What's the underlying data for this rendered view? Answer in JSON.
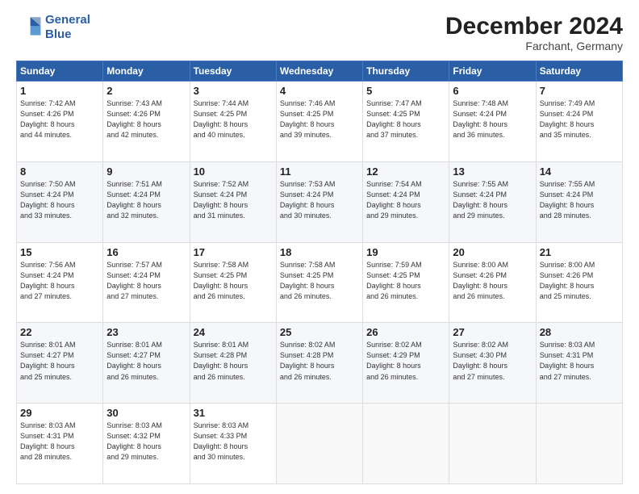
{
  "logo": {
    "line1": "General",
    "line2": "Blue"
  },
  "title": "December 2024",
  "subtitle": "Farchant, Germany",
  "days_of_week": [
    "Sunday",
    "Monday",
    "Tuesday",
    "Wednesday",
    "Thursday",
    "Friday",
    "Saturday"
  ],
  "weeks": [
    [
      {
        "day": "1",
        "detail": "Sunrise: 7:42 AM\nSunset: 4:26 PM\nDaylight: 8 hours\nand 44 minutes."
      },
      {
        "day": "2",
        "detail": "Sunrise: 7:43 AM\nSunset: 4:26 PM\nDaylight: 8 hours\nand 42 minutes."
      },
      {
        "day": "3",
        "detail": "Sunrise: 7:44 AM\nSunset: 4:25 PM\nDaylight: 8 hours\nand 40 minutes."
      },
      {
        "day": "4",
        "detail": "Sunrise: 7:46 AM\nSunset: 4:25 PM\nDaylight: 8 hours\nand 39 minutes."
      },
      {
        "day": "5",
        "detail": "Sunrise: 7:47 AM\nSunset: 4:25 PM\nDaylight: 8 hours\nand 37 minutes."
      },
      {
        "day": "6",
        "detail": "Sunrise: 7:48 AM\nSunset: 4:24 PM\nDaylight: 8 hours\nand 36 minutes."
      },
      {
        "day": "7",
        "detail": "Sunrise: 7:49 AM\nSunset: 4:24 PM\nDaylight: 8 hours\nand 35 minutes."
      }
    ],
    [
      {
        "day": "8",
        "detail": "Sunrise: 7:50 AM\nSunset: 4:24 PM\nDaylight: 8 hours\nand 33 minutes."
      },
      {
        "day": "9",
        "detail": "Sunrise: 7:51 AM\nSunset: 4:24 PM\nDaylight: 8 hours\nand 32 minutes."
      },
      {
        "day": "10",
        "detail": "Sunrise: 7:52 AM\nSunset: 4:24 PM\nDaylight: 8 hours\nand 31 minutes."
      },
      {
        "day": "11",
        "detail": "Sunrise: 7:53 AM\nSunset: 4:24 PM\nDaylight: 8 hours\nand 30 minutes."
      },
      {
        "day": "12",
        "detail": "Sunrise: 7:54 AM\nSunset: 4:24 PM\nDaylight: 8 hours\nand 29 minutes."
      },
      {
        "day": "13",
        "detail": "Sunrise: 7:55 AM\nSunset: 4:24 PM\nDaylight: 8 hours\nand 29 minutes."
      },
      {
        "day": "14",
        "detail": "Sunrise: 7:55 AM\nSunset: 4:24 PM\nDaylight: 8 hours\nand 28 minutes."
      }
    ],
    [
      {
        "day": "15",
        "detail": "Sunrise: 7:56 AM\nSunset: 4:24 PM\nDaylight: 8 hours\nand 27 minutes."
      },
      {
        "day": "16",
        "detail": "Sunrise: 7:57 AM\nSunset: 4:24 PM\nDaylight: 8 hours\nand 27 minutes."
      },
      {
        "day": "17",
        "detail": "Sunrise: 7:58 AM\nSunset: 4:25 PM\nDaylight: 8 hours\nand 26 minutes."
      },
      {
        "day": "18",
        "detail": "Sunrise: 7:58 AM\nSunset: 4:25 PM\nDaylight: 8 hours\nand 26 minutes."
      },
      {
        "day": "19",
        "detail": "Sunrise: 7:59 AM\nSunset: 4:25 PM\nDaylight: 8 hours\nand 26 minutes."
      },
      {
        "day": "20",
        "detail": "Sunrise: 8:00 AM\nSunset: 4:26 PM\nDaylight: 8 hours\nand 26 minutes."
      },
      {
        "day": "21",
        "detail": "Sunrise: 8:00 AM\nSunset: 4:26 PM\nDaylight: 8 hours\nand 25 minutes."
      }
    ],
    [
      {
        "day": "22",
        "detail": "Sunrise: 8:01 AM\nSunset: 4:27 PM\nDaylight: 8 hours\nand 25 minutes."
      },
      {
        "day": "23",
        "detail": "Sunrise: 8:01 AM\nSunset: 4:27 PM\nDaylight: 8 hours\nand 26 minutes."
      },
      {
        "day": "24",
        "detail": "Sunrise: 8:01 AM\nSunset: 4:28 PM\nDaylight: 8 hours\nand 26 minutes."
      },
      {
        "day": "25",
        "detail": "Sunrise: 8:02 AM\nSunset: 4:28 PM\nDaylight: 8 hours\nand 26 minutes."
      },
      {
        "day": "26",
        "detail": "Sunrise: 8:02 AM\nSunset: 4:29 PM\nDaylight: 8 hours\nand 26 minutes."
      },
      {
        "day": "27",
        "detail": "Sunrise: 8:02 AM\nSunset: 4:30 PM\nDaylight: 8 hours\nand 27 minutes."
      },
      {
        "day": "28",
        "detail": "Sunrise: 8:03 AM\nSunset: 4:31 PM\nDaylight: 8 hours\nand 27 minutes."
      }
    ],
    [
      {
        "day": "29",
        "detail": "Sunrise: 8:03 AM\nSunset: 4:31 PM\nDaylight: 8 hours\nand 28 minutes."
      },
      {
        "day": "30",
        "detail": "Sunrise: 8:03 AM\nSunset: 4:32 PM\nDaylight: 8 hours\nand 29 minutes."
      },
      {
        "day": "31",
        "detail": "Sunrise: 8:03 AM\nSunset: 4:33 PM\nDaylight: 8 hours\nand 30 minutes."
      },
      {
        "day": "",
        "detail": ""
      },
      {
        "day": "",
        "detail": ""
      },
      {
        "day": "",
        "detail": ""
      },
      {
        "day": "",
        "detail": ""
      }
    ]
  ]
}
